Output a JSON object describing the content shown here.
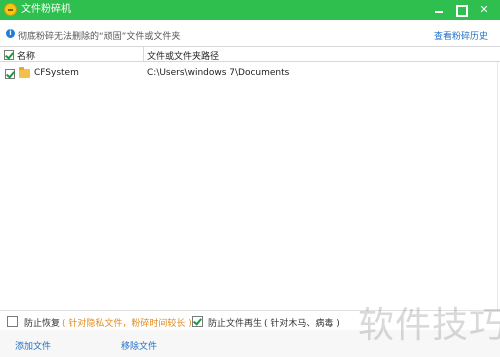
{
  "window": {
    "title": "文件粉碎机",
    "accent_color": "#2fbf4f",
    "controls": [
      "minimize-icon",
      "maximize-icon",
      "close-icon"
    ]
  },
  "infobar": {
    "icon": "info-icon",
    "message": "彻底粉碎无法删除的“顽固”文件或文件夹",
    "history_link": "查看粉碎历史"
  },
  "table": {
    "columns": [
      "名称",
      "文件或文件夹路径"
    ],
    "header_checked": true,
    "rows": [
      {
        "checked": true,
        "icon": "folder-icon",
        "name": "CFSystem",
        "path": "C:\\Users\\windows 7\\Documents"
      }
    ]
  },
  "options": {
    "prevent_recovery": {
      "checked": false,
      "label": "防止恢复",
      "note": "( 针对隐私文件，粉碎时间较长 )",
      "note_color": "#e08a1e"
    },
    "prevent_regeneration": {
      "checked": true,
      "label": "防止文件再生",
      "note": "( 针对木马、病毒 )"
    }
  },
  "actions": {
    "add_file": "添加文件",
    "remove_file": "移除文件"
  },
  "watermark": "软件技巧"
}
